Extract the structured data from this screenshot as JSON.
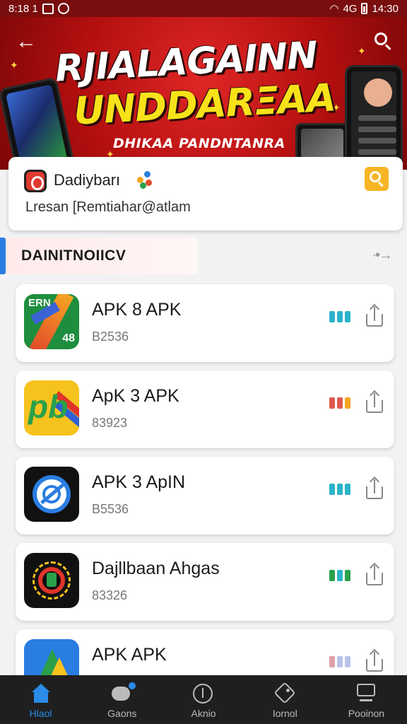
{
  "status_bar": {
    "time_left": "8:18 1",
    "time_right": "14:30",
    "signal_text": "4G"
  },
  "hero": {
    "title_line1": "RJIALAGAINN",
    "title_line2": "UNDDARΞAA",
    "subtitle": "DHIKAA PANDNTANRA"
  },
  "search_card": {
    "app_name": "Dadiybarı",
    "query": "Lresan [Remtiahar@atlam"
  },
  "section": {
    "title": "DAINITNOIICV",
    "more": "·•→"
  },
  "apps": [
    {
      "title": "APK 8 APK",
      "meta": "B2536",
      "icon": "app-icon-green-slash",
      "icon_text_top": "ERN",
      "icon_text_bottom": "48",
      "signal_color": "#2bb3c9"
    },
    {
      "title": "ApK 3 APK",
      "meta": "83923",
      "icon": "app-icon-yellow-pb",
      "icon_text": "pb",
      "signal_color": "#e05a4e"
    },
    {
      "title": "APK 3 ApIN",
      "meta": "B5536",
      "icon": "app-icon-blue-ring",
      "signal_color": "#2bb3c9"
    },
    {
      "title": "Dajllbaan Ahgas",
      "meta": "83326",
      "icon": "app-icon-dark-circle",
      "signal_color": "#2aa04a"
    },
    {
      "title": "APK APK",
      "meta": "",
      "icon": "app-icon-blue-triangle",
      "signal_color": "#b9c3e8"
    }
  ],
  "bottom_nav": [
    {
      "label": "Hlaol",
      "icon": "home-icon",
      "active": true
    },
    {
      "label": "Gaons",
      "icon": "chat-icon",
      "active": false
    },
    {
      "label": "Aknio",
      "icon": "alert-icon",
      "active": false
    },
    {
      "label": "Iornol",
      "icon": "tag-icon",
      "active": false
    },
    {
      "label": "Pooinon",
      "icon": "monitor-icon",
      "active": false
    }
  ],
  "colors": {
    "accent": "#2a7de1",
    "brand_red": "#c8121a",
    "highlight_yellow": "#f7e21a"
  }
}
